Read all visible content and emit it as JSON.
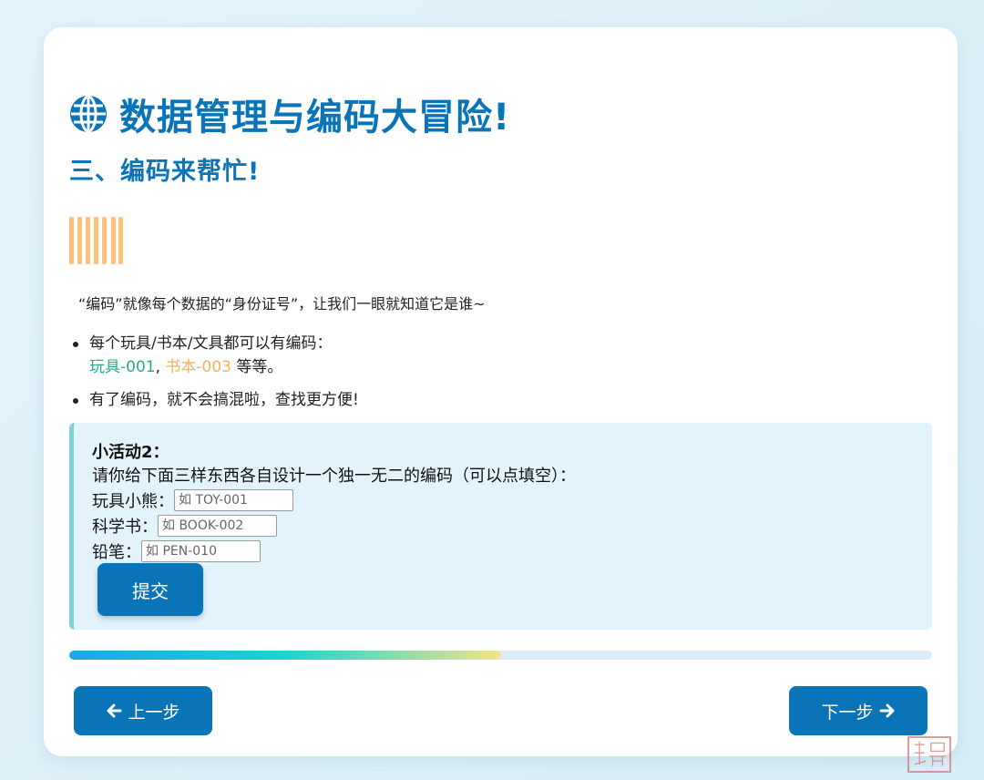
{
  "header": {
    "title": "数据管理与编码大冒险!",
    "subtitle": "三、编码来帮忙!"
  },
  "content": {
    "intro": "“编码”就像每个数据的“身份证号”，让我们一眼就知道它是谁~",
    "bullet1_text": "每个玩具/书本/文具都可以有编码：",
    "bullet1_code_a": "玩具-001",
    "bullet1_comma": ", ",
    "bullet1_code_b": "书本-003",
    "bullet1_suffix": " 等等。",
    "bullet2_text": "有了编码，就不会搞混啦，查找更方便!"
  },
  "activity": {
    "title": "小活动2：",
    "description": "请你给下面三样东西各自设计一个独一无二的编码（可以点填空）：",
    "fields": [
      {
        "label": "玩具小熊：",
        "placeholder": "如 TOY-001",
        "value": ""
      },
      {
        "label": "科学书：",
        "placeholder": "如 BOOK-002",
        "value": ""
      },
      {
        "label": "铅笔：",
        "placeholder": "如 PEN-010",
        "value": ""
      }
    ],
    "submit_label": "提交"
  },
  "progress": {
    "fraction": 0.5
  },
  "nav": {
    "prev_label": "上一步",
    "next_label": "下一步"
  },
  "colors": {
    "primary": "#0a74b8",
    "code_green": "#2aa88e",
    "code_orange": "#f2b35e",
    "barcode": "#ffc07a",
    "activity_bg": "#e3f3fc"
  },
  "icons": [
    "globe-icon",
    "barcode-icon",
    "arrow-left-icon",
    "arrow-right-icon",
    "watermark-stamp"
  ]
}
